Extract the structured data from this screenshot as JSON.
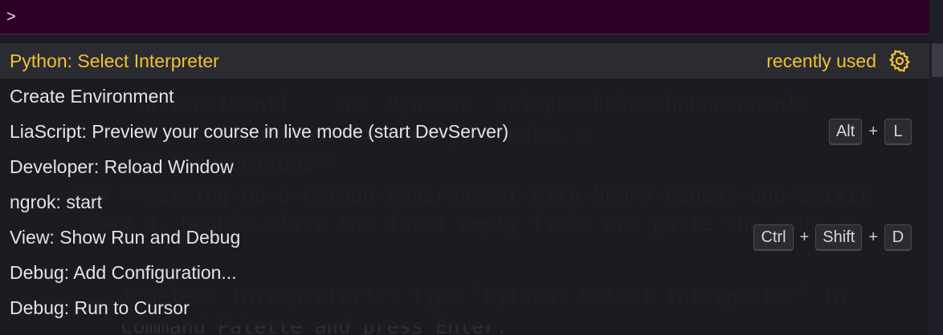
{
  "palette": {
    "prompt": ">",
    "items": [
      {
        "label": "Python: Select Interpreter",
        "detail": "recently used",
        "icon": "gear-icon",
        "selected": true,
        "keys": []
      },
      {
        "label": "Create Environment",
        "keys": []
      },
      {
        "label": "LiaScript: Preview your course in live mode (start DevServer)",
        "keys": [
          "Alt",
          "L"
        ]
      },
      {
        "label": "Developer: Reload Window",
        "keys": []
      },
      {
        "label": "ngrok: start",
        "keys": []
      },
      {
        "label": "View: Show Run and Debug",
        "keys": [
          "Ctrl",
          "Shift",
          "D"
        ]
      },
      {
        "label": "Debug: Add Configuration...",
        "keys": []
      },
      {
        "label": "Debug: Run to Cursor",
        "keys": []
      }
    ],
    "key_separator": "+"
  },
  "background_editor": {
    "lines": [
      "                 # 014bpuiderd",
      "           lazisutiwenti    n2  Pyumebn  nnimpnmnhnlnmnhnPuutnhsnlt",
      "                  vironment with NumPy, Pandas, a",
      "           up-Instructions**",
      "      ### **Setting-Up-a-Python-Environment-with-NumPy-Pandas-and-Scikit",
      "       #### 4. Double-click the first empty field and paste the code in",
      "",
      "          **Select Interpreter**: Type `Python: Select Interpreter` in",
      "          Command Palette and press Enter."
    ]
  },
  "colors": {
    "accent": "#f1c232",
    "input_background": "#2c0028",
    "list_background": "#1b1b22",
    "selected_background": "#2c2c34",
    "text": "#e4e4e4"
  }
}
